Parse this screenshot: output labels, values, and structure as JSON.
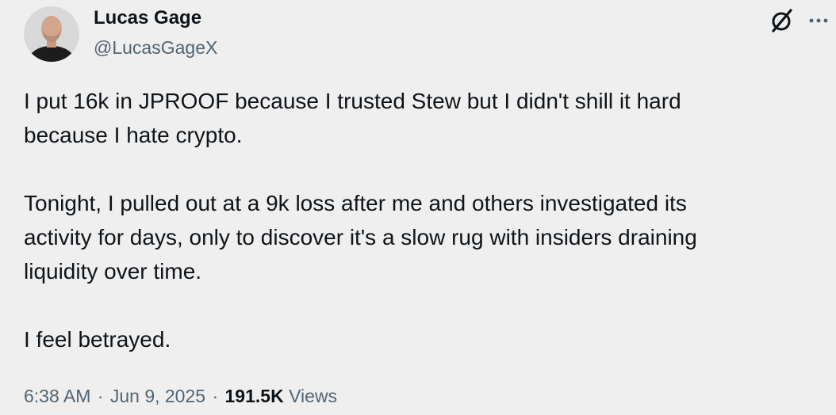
{
  "tweet": {
    "author": {
      "display_name": "Lucas Gage",
      "handle": "@LucasGageX"
    },
    "paragraphs": [
      "I put 16k in JPROOF because I trusted Stew but I didn't shill it hard\nbecause I hate crypto.",
      "Tonight, I pulled out at a 9k loss after me and others investigated its\nactivity for days, only to discover it's a slow rug with insiders draining\nliquidity over time.",
      "I feel betrayed."
    ],
    "time": "6:38 AM",
    "date": "Jun 9, 2025",
    "separator": "·",
    "views_count": "191.5K",
    "views_label": "Views"
  },
  "icons": {
    "grok": "grok-icon",
    "more": "more-options-icon"
  }
}
